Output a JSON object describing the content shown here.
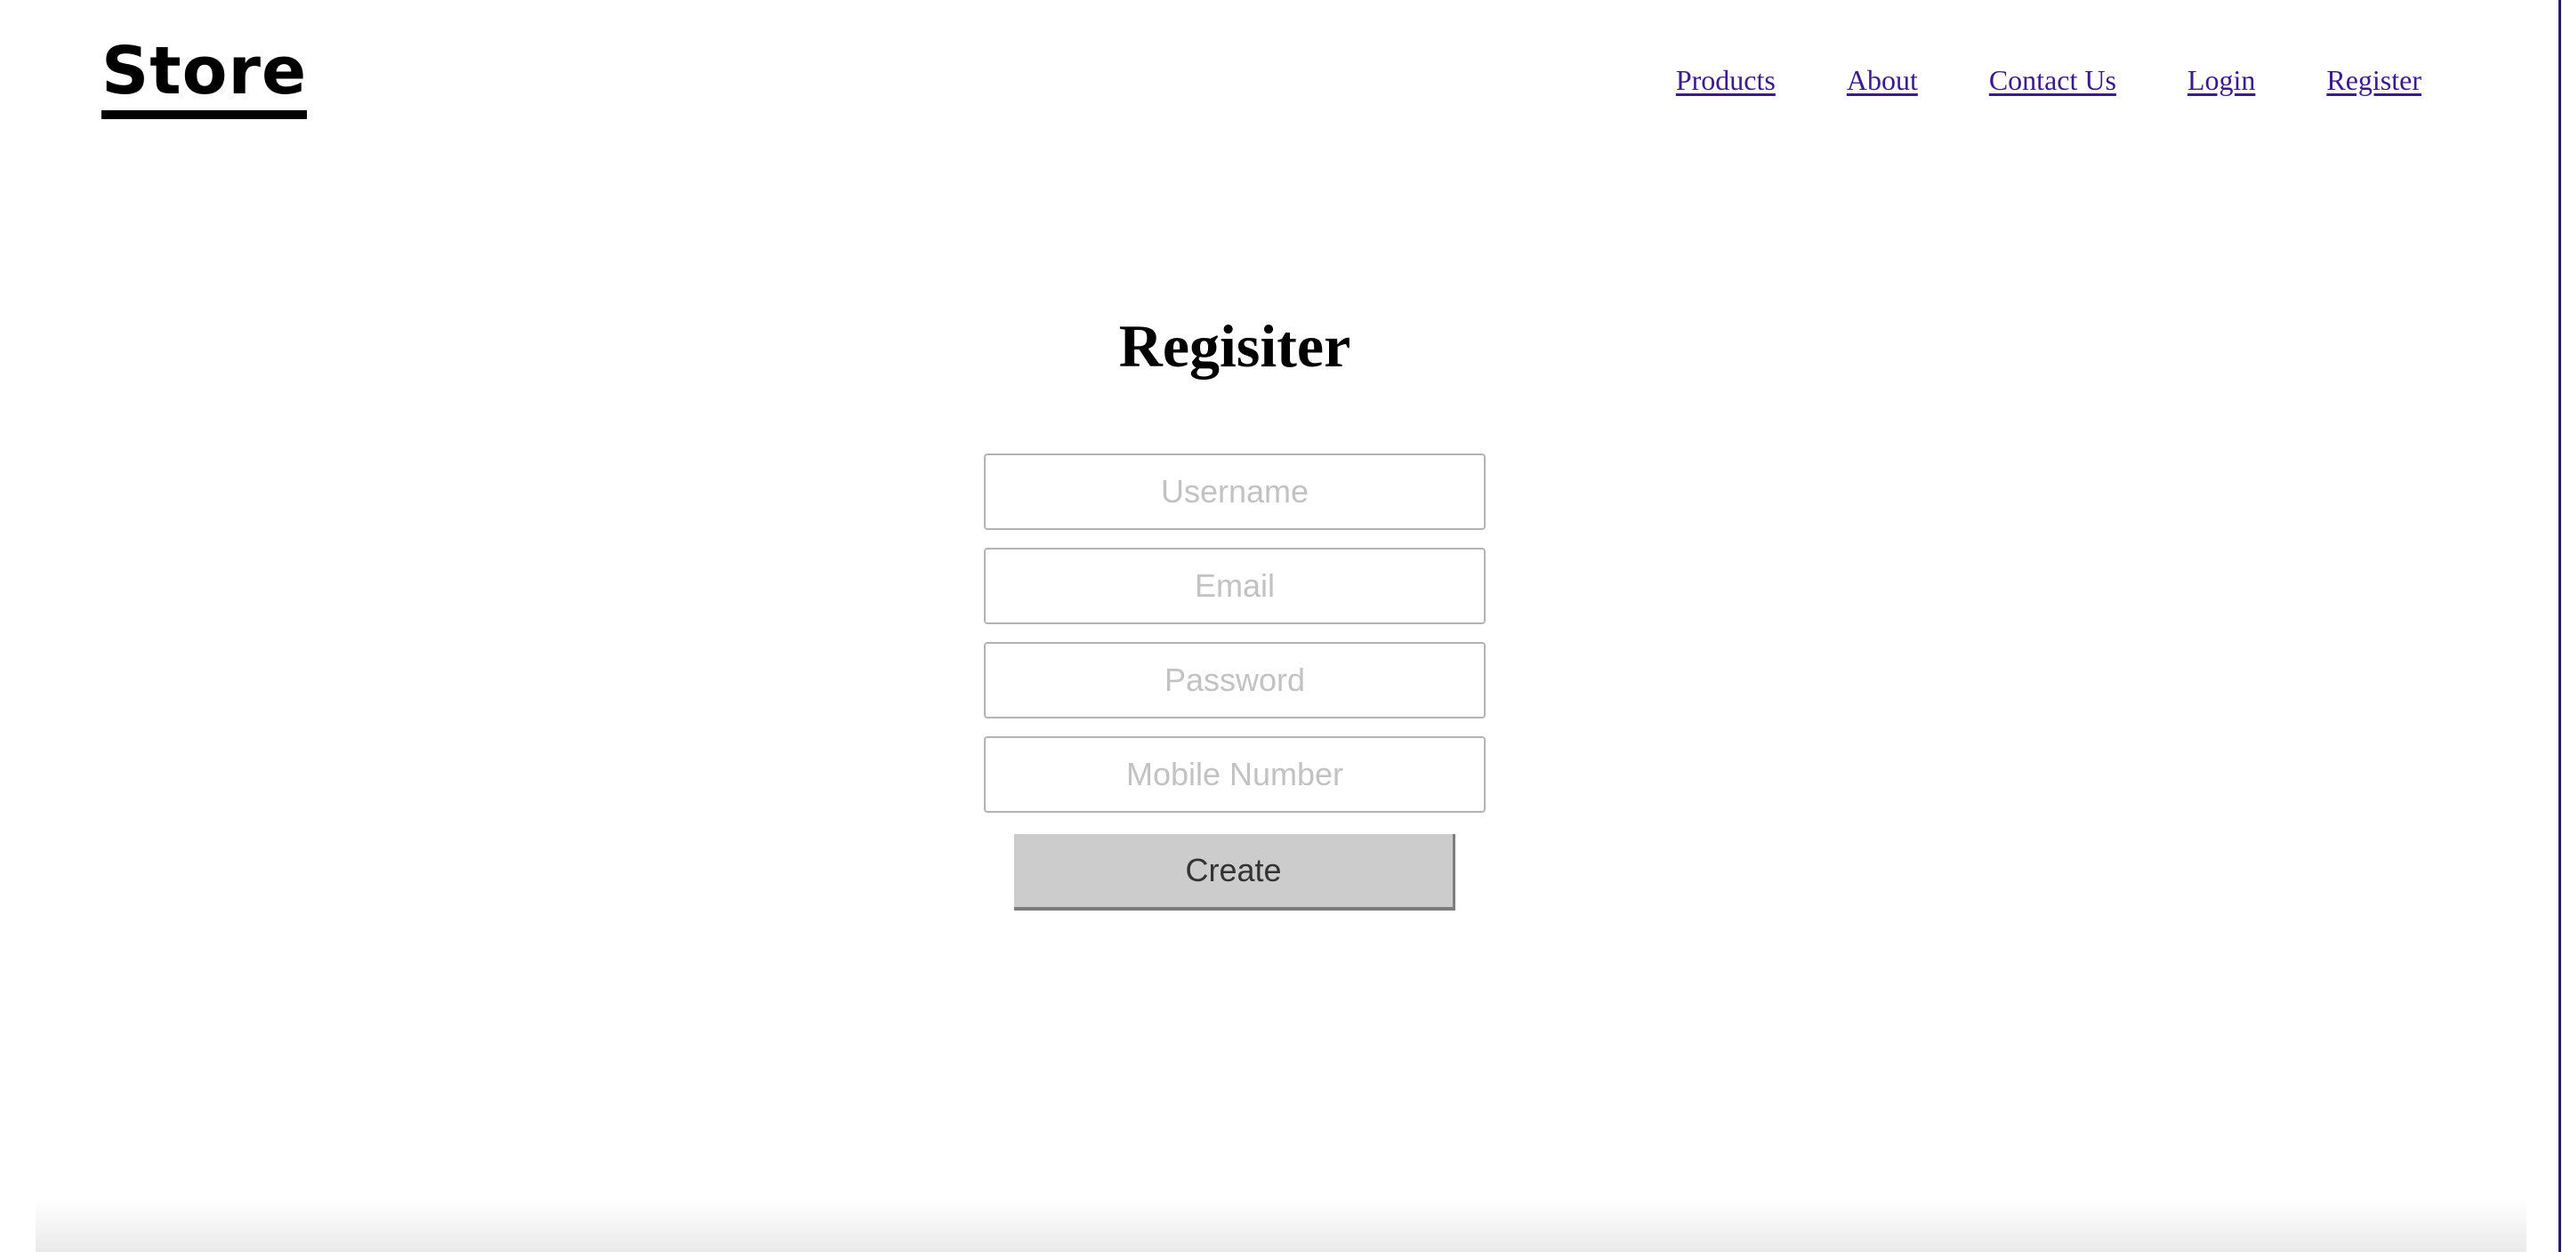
{
  "header": {
    "logo": "Store",
    "nav": [
      {
        "label": "Products"
      },
      {
        "label": "About"
      },
      {
        "label": "Contact Us"
      },
      {
        "label": "Login"
      },
      {
        "label": "Register"
      }
    ]
  },
  "main": {
    "title": "Regisiter",
    "fields": {
      "username": {
        "placeholder": "Username",
        "value": ""
      },
      "email": {
        "placeholder": "Email",
        "value": ""
      },
      "password": {
        "placeholder": "Password",
        "value": ""
      },
      "mobile": {
        "placeholder": "Mobile Number",
        "value": ""
      }
    },
    "submit_label": "Create"
  },
  "colors": {
    "link": "#3b1a8c",
    "button_bg": "#cccccc",
    "input_border": "#b3b3b3",
    "placeholder": "#c2c2c2"
  }
}
